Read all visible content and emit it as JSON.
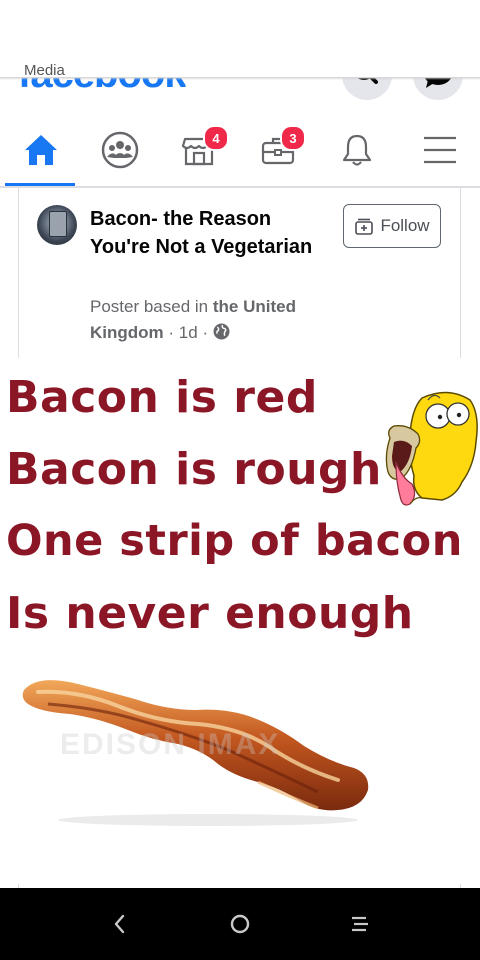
{
  "header": {
    "media_label": "Media",
    "logo_text": "facebook"
  },
  "tabs": {
    "active": "home",
    "items": [
      {
        "name": "home",
        "icon": "home-icon"
      },
      {
        "name": "groups",
        "icon": "groups-icon"
      },
      {
        "name": "marketplace",
        "icon": "marketplace-icon",
        "badge": "4"
      },
      {
        "name": "jobs",
        "icon": "briefcase-icon",
        "badge": "3"
      },
      {
        "name": "notifications",
        "icon": "bell-icon"
      },
      {
        "name": "menu",
        "icon": "hamburger-menu-icon"
      }
    ]
  },
  "post": {
    "page_name": "Bacon- the Reason You're Not a Vegetarian",
    "meta_prefix": "Poster based in",
    "meta_location": "the United Kingdom",
    "meta_time": "1d",
    "meta_separator": "·",
    "follow_label": "Follow"
  },
  "meme": {
    "lines": [
      "Bacon is red",
      "Bacon is rough",
      "One strip of bacon",
      "Is never enough"
    ],
    "watermark": "EDISON IMAX",
    "text_color": "#8b1626"
  },
  "colors": {
    "brand": "#1877f2",
    "badge": "#f02849",
    "icon_gray": "#65676b"
  }
}
